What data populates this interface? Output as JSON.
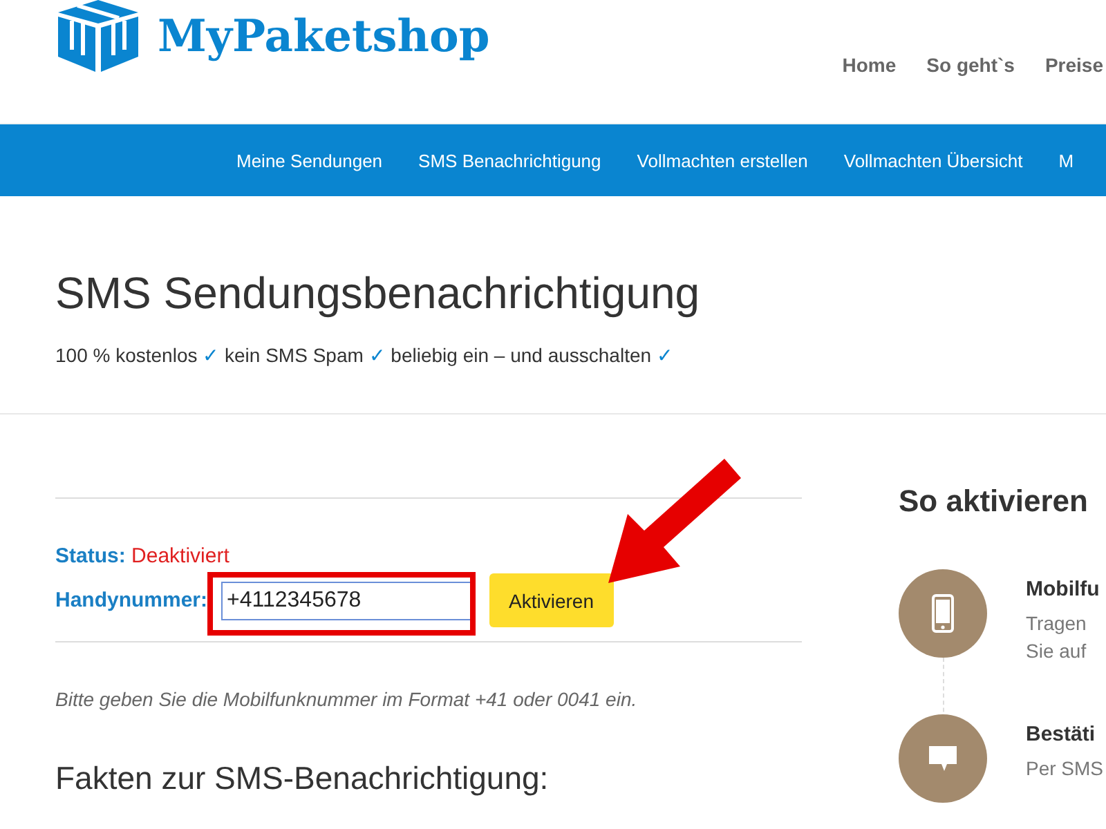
{
  "logo": {
    "text": "MyPaketshop"
  },
  "top_nav": [
    {
      "label": "Home"
    },
    {
      "label": "So geht`s"
    },
    {
      "label": "Preise"
    }
  ],
  "main_nav": [
    {
      "label": "Meine Sendungen"
    },
    {
      "label": "SMS Benachrichtigung"
    },
    {
      "label": "Vollmachten erstellen"
    },
    {
      "label": "Vollmachten Übersicht"
    },
    {
      "label": "M"
    }
  ],
  "page": {
    "title": "SMS Sendungsbenachrichtigung",
    "tagline": [
      {
        "text": "100 % kostenlos",
        "check": "✓"
      },
      {
        "text": "kein SMS Spam",
        "check": "✓"
      },
      {
        "text": "beliebig ein – und ausschalten",
        "check": "✓"
      }
    ]
  },
  "form": {
    "status_label": "Status:",
    "status_value": "Deaktiviert",
    "phone_label": "Handynummer:",
    "phone_value": "+4112345678",
    "button": "Aktivieren",
    "hint": "Bitte geben Sie die Mobilfunknummer im Format +41 oder 0041 ein.",
    "highlighted": true
  },
  "facts_heading": "Fakten zur SMS-Benachrichtigung:",
  "steps_panel": {
    "heading": "So aktivieren",
    "steps": [
      {
        "kind": "phone",
        "title": "Mobilfu",
        "lines": [
          "Tragen",
          "Sie auf"
        ]
      },
      {
        "kind": "chat",
        "title": "Bestäti",
        "lines": [
          "Per SMS"
        ]
      }
    ]
  }
}
